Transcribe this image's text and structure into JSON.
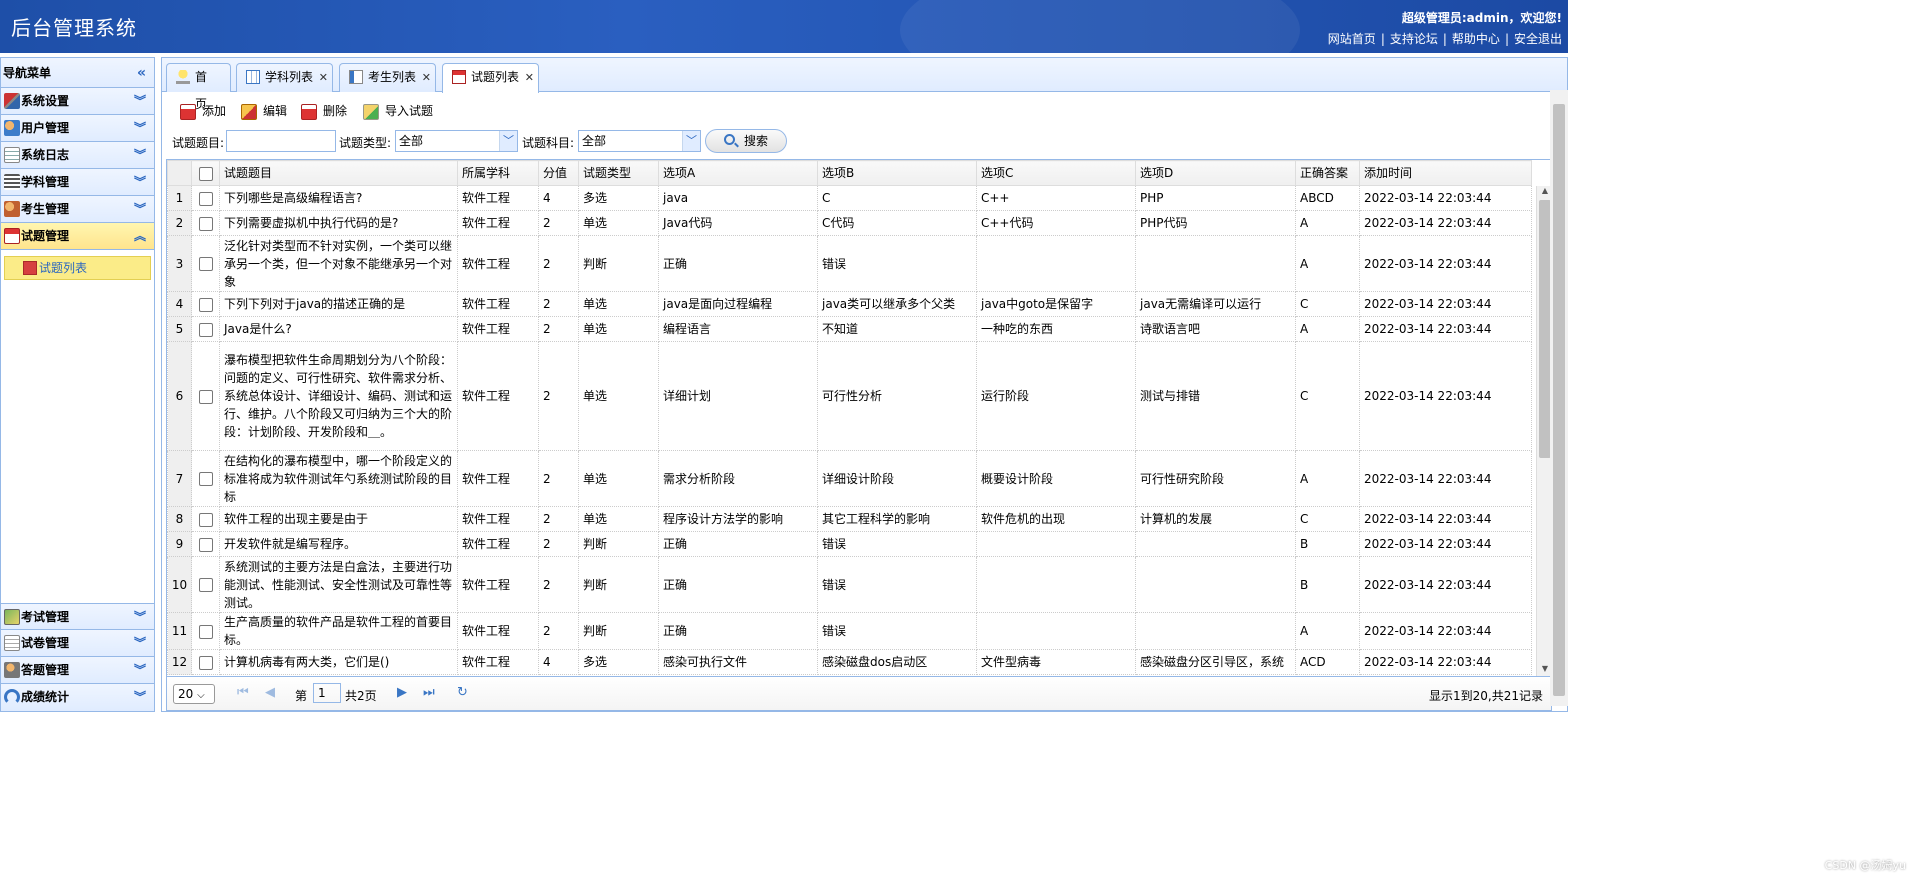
{
  "header": {
    "title": "后台管理系统",
    "welcome": "超级管理员:admin，欢迎您!",
    "links": [
      "网站首页",
      "支持论坛",
      "帮助中心",
      "安全退出"
    ],
    "separator": "|"
  },
  "sidebar": {
    "title": "导航菜单",
    "menus": [
      {
        "label": "系统设置",
        "icon": "tools-icon"
      },
      {
        "label": "用户管理",
        "icon": "users-icon"
      },
      {
        "label": "系统日志",
        "icon": "log-icon"
      },
      {
        "label": "学科管理",
        "icon": "list-icon"
      },
      {
        "label": "考生管理",
        "icon": "students-icon"
      },
      {
        "label": "试题管理",
        "icon": "calendar-icon",
        "active": true
      }
    ],
    "sub_item": "试题列表",
    "bottom_menus": [
      {
        "label": "考试管理",
        "icon": "exam-icon"
      },
      {
        "label": "试卷管理",
        "icon": "paper-icon"
      },
      {
        "label": "答题管理",
        "icon": "answer-icon"
      },
      {
        "label": "成绩统计",
        "icon": "stats-icon"
      }
    ]
  },
  "tabs": [
    {
      "label": "首页",
      "icon": "bulb-icon",
      "closable": false
    },
    {
      "label": "学科列表",
      "icon": "table-icon",
      "closable": true
    },
    {
      "label": "考生列表",
      "icon": "card-icon",
      "closable": true
    },
    {
      "label": "试题列表",
      "icon": "calendar-icon",
      "closable": true,
      "selected": true
    }
  ],
  "toolbar": {
    "add": "添加",
    "edit": "编辑",
    "delete": "删除",
    "import": "导入试题"
  },
  "filter": {
    "title_label": "试题题目:",
    "title_value": "",
    "type_label": "试题类型:",
    "type_value": "全部",
    "subject_label": "试题科目:",
    "subject_value": "全部",
    "search": "搜索"
  },
  "grid": {
    "columns": [
      "试题题目",
      "所属学科",
      "分值",
      "试题类型",
      "选项A",
      "选项B",
      "选项C",
      "选项D",
      "正确答案",
      "添加时间"
    ],
    "rows": [
      [
        "下列哪些是高级编程语言?",
        "软件工程",
        "4",
        "多选",
        "java",
        "C",
        "C++",
        "PHP",
        "ABCD",
        "2022-03-14 22:03:44"
      ],
      [
        "下列需要虚拟机中执行代码的是?",
        "软件工程",
        "2",
        "单选",
        "Java代码",
        "C代码",
        "C++代码",
        "PHP代码",
        "A",
        "2022-03-14 22:03:44"
      ],
      [
        "泛化针对类型而不针对实例，一个类可以继承另一个类，但一个对象不能继承另一个对象",
        "软件工程",
        "2",
        "判断",
        "正确",
        "错误",
        "",
        "",
        "A",
        "2022-03-14 22:03:44"
      ],
      [
        "下列下列对于java的描述正确的是",
        "软件工程",
        "2",
        "单选",
        "java是面向过程编程",
        "java类可以继承多个父类",
        "java中goto是保留字",
        "java无需编译可以运行",
        "C",
        "2022-03-14 22:03:44"
      ],
      [
        "Java是什么?",
        "软件工程",
        "2",
        "单选",
        "编程语言",
        "不知道",
        "一种吃的东西",
        "诗歌语言吧",
        "A",
        "2022-03-14 22:03:44"
      ],
      [
        "瀑布模型把软件生命周期划分为八个阶段：问题的定义、可行性研究、软件需求分析、系统总体设计、详细设计、编码、测试和运行、维护。八个阶段又可归纳为三个大的阶段：计划阶段、开发阶段和＿。",
        "软件工程",
        "2",
        "单选",
        "详细计划",
        "可行性分析",
        "运行阶段",
        "测试与排错",
        "C",
        "2022-03-14 22:03:44"
      ],
      [
        "在结构化的瀑布模型中，哪一个阶段定义的标准将成为软件测试年勺系统测试阶段的目标",
        "软件工程",
        "2",
        "单选",
        "需求分析阶段",
        "详细设计阶段",
        "概要设计阶段",
        "可行性研究阶段",
        "A",
        "2022-03-14 22:03:44"
      ],
      [
        "软件工程的出现主要是由于",
        "软件工程",
        "2",
        "单选",
        "程序设计方法学的影响",
        "其它工程科学的影响",
        "软件危机的出现",
        "计算机的发展",
        "C",
        "2022-03-14 22:03:44"
      ],
      [
        "开发软件就是编写程序。",
        "软件工程",
        "2",
        "判断",
        "正确",
        "错误",
        "",
        "",
        "B",
        "2022-03-14 22:03:44"
      ],
      [
        "系统测试的主要方法是白盒法，主要进行功能测试、性能测试、安全性测试及可靠性等测试。",
        "软件工程",
        "2",
        "判断",
        "正确",
        "错误",
        "",
        "",
        "B",
        "2022-03-14 22:03:44"
      ],
      [
        "生产高质量的软件产品是软件工程的首要目标。",
        "软件工程",
        "2",
        "判断",
        "正确",
        "错误",
        "",
        "",
        "A",
        "2022-03-14 22:03:44"
      ],
      [
        "计算机病毒有两大类，它们是()",
        "软件工程",
        "4",
        "多选",
        "感染可执行文件",
        "感染磁盘dos启动区",
        "文件型病毒",
        "感染磁盘分区引导区，系统",
        "ACD",
        "2022-03-14 22:03:44"
      ]
    ]
  },
  "pager": {
    "page_size": "20",
    "page_label": "第",
    "page_value": "1",
    "total_pages": "共2页",
    "info": "显示1到20,共21记录"
  },
  "watermark": "CSDN @汤姆yu"
}
